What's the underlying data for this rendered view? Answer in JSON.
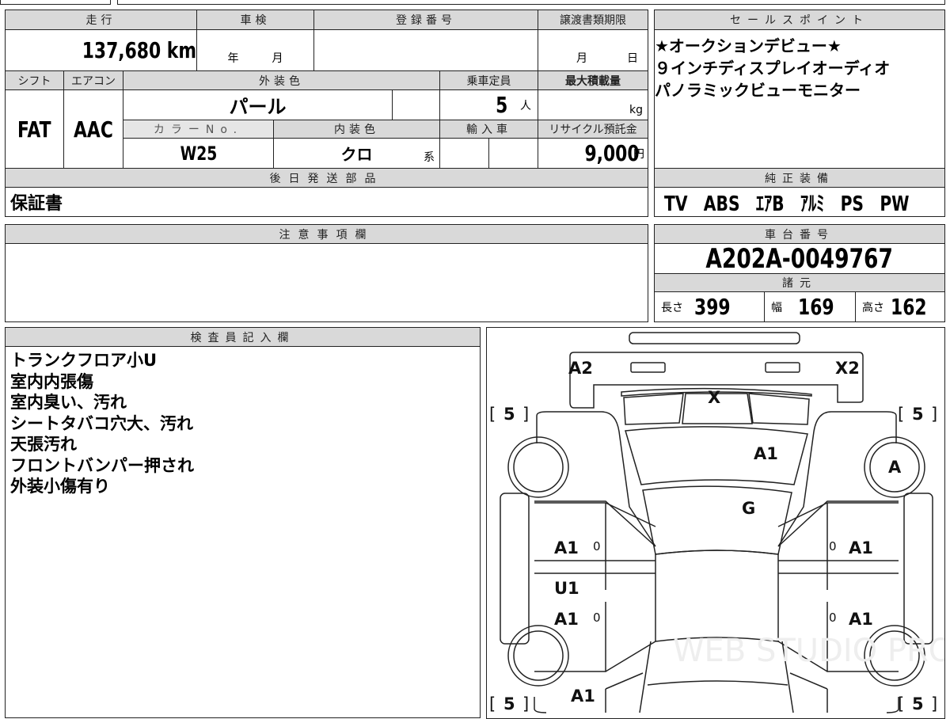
{
  "top_table": {
    "mileage_label": "走行",
    "mileage": "137,680 km",
    "shaken_label": "車検",
    "shaken_year": "年",
    "shaken_month": "月",
    "registration_label": "登録番号",
    "registration": "",
    "transfer_deadline_label": "譲渡書類期限",
    "transfer_month": "月",
    "transfer_day": "日",
    "shift_label": "シフト",
    "shift": "FAT",
    "aircon_label": "エアコン",
    "aircon": "AAC",
    "exterior_color_label": "外装色",
    "exterior_color": "パール",
    "capacity_label": "乗車定員",
    "capacity": "5",
    "capacity_unit": "人",
    "max_load_label": "最大積載量",
    "max_load_unit": "kg",
    "color_no_label": "カラーNo.",
    "color_no": "W25",
    "interior_color_label": "内装色",
    "interior_color": "クロ",
    "interior_suffix": "系",
    "import_label": "輸入車",
    "recycle_label": "リサイクル預託金",
    "recycle_fee": "9,000",
    "recycle_unit": "円",
    "later_parts_label": "後日発送部品",
    "later_parts": "保証書"
  },
  "sales_points": {
    "label": "セールスポイント",
    "lines": [
      "★オークションデビュー★",
      "９インチディスプレイオーディオ",
      "パノラミックビューモニター"
    ]
  },
  "equipment": {
    "label": "純正装備",
    "value": "TV　ABS　ｴｱB　ｱﾙﾐ　PS　PW"
  },
  "notes": {
    "label": "注意事項欄"
  },
  "chassis": {
    "label": "車台番号",
    "number": "A202A-0049767",
    "spec_label": "諸元",
    "length_label": "長さ",
    "length": "399",
    "width_label": "幅",
    "width": "169",
    "height_label": "高さ",
    "height": "162"
  },
  "inspector": {
    "label": "検査員記入欄",
    "lines": [
      "トランクフロア小U",
      "室内内張傷",
      "室内臭い、汚れ",
      "シートタバコ穴大、汚れ",
      "天張汚れ",
      "フロントバンパー押され",
      "外装小傷有り"
    ]
  },
  "diagram": {
    "marks": {
      "rear_left": "A2",
      "rear_right": "X2",
      "rear_glass": "X",
      "roof": "A1",
      "wheel_fr": "A",
      "windshield": "G",
      "rear_door_l": "A1",
      "rear_door_r": "A1",
      "step_l": "U1",
      "front_door_l": "A1",
      "front_door_r": "A1",
      "front_fender_l": "A1",
      "zero": "0"
    },
    "tires": [
      "5",
      "5",
      "5",
      "5"
    ],
    "watermark": "WEB STUDIO PRO"
  }
}
